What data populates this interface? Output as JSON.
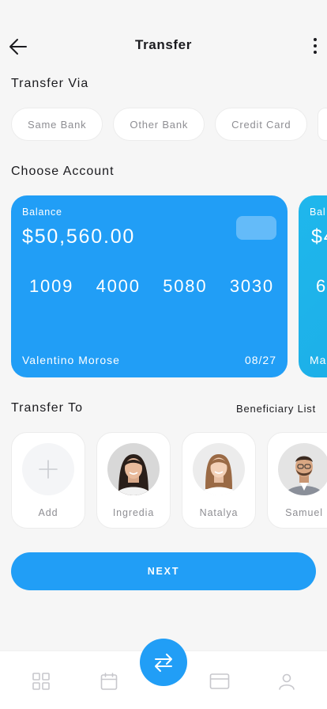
{
  "header": {
    "title": "Transfer"
  },
  "transfer_via": {
    "title": "Transfer Via",
    "options": [
      "Same Bank",
      "Other Bank",
      "Credit Card"
    ]
  },
  "choose_account": {
    "title": "Choose Account",
    "cards": [
      {
        "balance_label": "Balance",
        "balance": "$50,560.00",
        "number_groups": [
          "1009",
          "4000",
          "5080",
          "3030"
        ],
        "holder": "Valentino Morose",
        "expiry": "08/27"
      },
      {
        "balance_label": "Bal",
        "balance": "$4",
        "number_first": "6",
        "holder": "Ma"
      }
    ]
  },
  "transfer_to": {
    "title": "Transfer To",
    "beneficiary_link": "Beneficiary List",
    "add_label": "Add",
    "contacts": [
      {
        "name": "Ingredia"
      },
      {
        "name": "Natalya"
      },
      {
        "name": "Samuel"
      }
    ]
  },
  "next_button": "NEXT",
  "colors": {
    "accent": "#219ef6",
    "card_alt": "#1fb7ec",
    "muted_text": "#8e8e93"
  },
  "nav": {
    "icons": [
      "grid-icon",
      "calendar-icon",
      "transfer-icon",
      "card-icon",
      "profile-icon"
    ]
  }
}
